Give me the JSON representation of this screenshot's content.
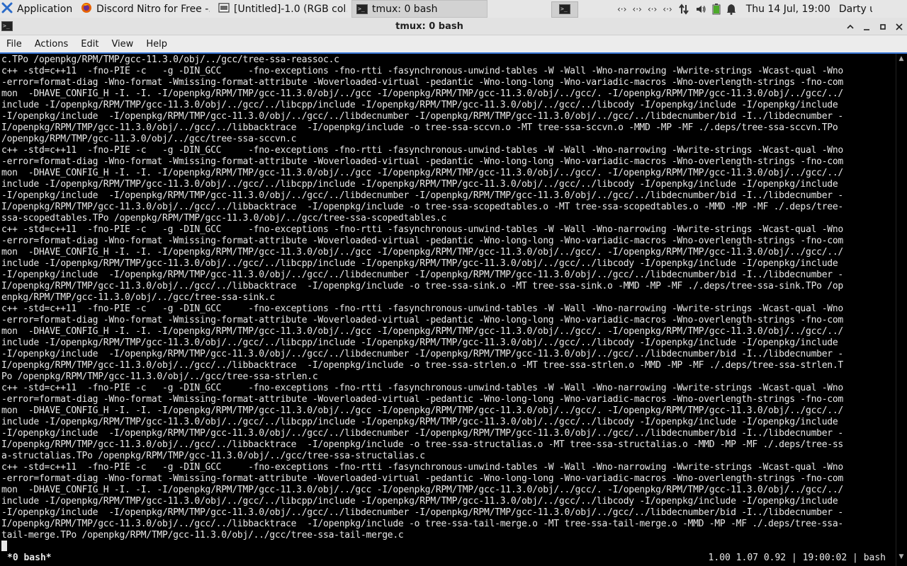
{
  "panel": {
    "apps_label": "Applications",
    "tasks": [
      {
        "label": "Discord Nitro for Free -...",
        "icon": "firefox-icon"
      },
      {
        "label": "[Untitled]-1.0 (RGB col...",
        "icon": "gimp-icon"
      },
      {
        "label": "tmux: 0 bash",
        "icon": "terminal-icon"
      }
    ],
    "tray": {
      "network_icons": [
        "network-icon",
        "network-icon",
        "network-icon",
        "network-icon"
      ],
      "other_icons": [
        "transfer-icon",
        "volume-icon",
        "battery-icon",
        "notification-bell-icon"
      ]
    },
    "clock": "Thu 14 Jul, 19:00",
    "user": "Darty uwu"
  },
  "window": {
    "title": "tmux: 0 bash"
  },
  "menubar": {
    "items": [
      "File",
      "Actions",
      "Edit",
      "View",
      "Help"
    ]
  },
  "terminal": {
    "lines": [
      "c.TPo /openpkg/RPM/TMP/gcc-11.3.0/obj/../gcc/tree-ssa-reassoc.c",
      "c++ -std=c++11  -fno-PIE -c   -g -DIN_GCC     -fno-exceptions -fno-rtti -fasynchronous-unwind-tables -W -Wall -Wno-narrowing -Wwrite-strings -Wcast-qual -Wno",
      "-error=format-diag -Wno-format -Wmissing-format-attribute -Woverloaded-virtual -pedantic -Wno-long-long -Wno-variadic-macros -Wno-overlength-strings -fno-com",
      "mon  -DHAVE_CONFIG_H -I. -I. -I/openpkg/RPM/TMP/gcc-11.3.0/obj/../gcc -I/openpkg/RPM/TMP/gcc-11.3.0/obj/../gcc/. -I/openpkg/RPM/TMP/gcc-11.3.0/obj/../gcc/../",
      "include -I/openpkg/RPM/TMP/gcc-11.3.0/obj/../gcc/../libcpp/include -I/openpkg/RPM/TMP/gcc-11.3.0/obj/../gcc/../libcody -I/openpkg/include -I/openpkg/include",
      "-I/openpkg/include  -I/openpkg/RPM/TMP/gcc-11.3.0/obj/../gcc/../libdecnumber -I/openpkg/RPM/TMP/gcc-11.3.0/obj/../gcc/../libdecnumber/bid -I../libdecnumber -",
      "I/openpkg/RPM/TMP/gcc-11.3.0/obj/../gcc/../libbacktrace  -I/openpkg/include -o tree-ssa-sccvn.o -MT tree-ssa-sccvn.o -MMD -MP -MF ./.deps/tree-ssa-sccvn.TPo",
      "/openpkg/RPM/TMP/gcc-11.3.0/obj/../gcc/tree-ssa-sccvn.c",
      "c++ -std=c++11  -fno-PIE -c   -g -DIN_GCC     -fno-exceptions -fno-rtti -fasynchronous-unwind-tables -W -Wall -Wno-narrowing -Wwrite-strings -Wcast-qual -Wno",
      "-error=format-diag -Wno-format -Wmissing-format-attribute -Woverloaded-virtual -pedantic -Wno-long-long -Wno-variadic-macros -Wno-overlength-strings -fno-com",
      "mon  -DHAVE_CONFIG_H -I. -I. -I/openpkg/RPM/TMP/gcc-11.3.0/obj/../gcc -I/openpkg/RPM/TMP/gcc-11.3.0/obj/../gcc/. -I/openpkg/RPM/TMP/gcc-11.3.0/obj/../gcc/../",
      "include -I/openpkg/RPM/TMP/gcc-11.3.0/obj/../gcc/../libcpp/include -I/openpkg/RPM/TMP/gcc-11.3.0/obj/../gcc/../libcody -I/openpkg/include -I/openpkg/include",
      "-I/openpkg/include  -I/openpkg/RPM/TMP/gcc-11.3.0/obj/../gcc/../libdecnumber -I/openpkg/RPM/TMP/gcc-11.3.0/obj/../gcc/../libdecnumber/bid -I../libdecnumber -",
      "I/openpkg/RPM/TMP/gcc-11.3.0/obj/../gcc/../libbacktrace  -I/openpkg/include -o tree-ssa-scopedtables.o -MT tree-ssa-scopedtables.o -MMD -MP -MF ./.deps/tree-",
      "ssa-scopedtables.TPo /openpkg/RPM/TMP/gcc-11.3.0/obj/../gcc/tree-ssa-scopedtables.c",
      "c++ -std=c++11  -fno-PIE -c   -g -DIN_GCC     -fno-exceptions -fno-rtti -fasynchronous-unwind-tables -W -Wall -Wno-narrowing -Wwrite-strings -Wcast-qual -Wno",
      "-error=format-diag -Wno-format -Wmissing-format-attribute -Woverloaded-virtual -pedantic -Wno-long-long -Wno-variadic-macros -Wno-overlength-strings -fno-com",
      "mon  -DHAVE_CONFIG_H -I. -I. -I/openpkg/RPM/TMP/gcc-11.3.0/obj/../gcc -I/openpkg/RPM/TMP/gcc-11.3.0/obj/../gcc/. -I/openpkg/RPM/TMP/gcc-11.3.0/obj/../gcc/../",
      "include -I/openpkg/RPM/TMP/gcc-11.3.0/obj/../gcc/../libcpp/include -I/openpkg/RPM/TMP/gcc-11.3.0/obj/../gcc/../libcody -I/openpkg/include -I/openpkg/include",
      "-I/openpkg/include  -I/openpkg/RPM/TMP/gcc-11.3.0/obj/../gcc/../libdecnumber -I/openpkg/RPM/TMP/gcc-11.3.0/obj/../gcc/../libdecnumber/bid -I../libdecnumber -",
      "I/openpkg/RPM/TMP/gcc-11.3.0/obj/../gcc/../libbacktrace  -I/openpkg/include -o tree-ssa-sink.o -MT tree-ssa-sink.o -MMD -MP -MF ./.deps/tree-ssa-sink.TPo /op",
      "enpkg/RPM/TMP/gcc-11.3.0/obj/../gcc/tree-ssa-sink.c",
      "c++ -std=c++11  -fno-PIE -c   -g -DIN_GCC     -fno-exceptions -fno-rtti -fasynchronous-unwind-tables -W -Wall -Wno-narrowing -Wwrite-strings -Wcast-qual -Wno",
      "-error=format-diag -Wno-format -Wmissing-format-attribute -Woverloaded-virtual -pedantic -Wno-long-long -Wno-variadic-macros -Wno-overlength-strings -fno-com",
      "mon  -DHAVE_CONFIG_H -I. -I. -I/openpkg/RPM/TMP/gcc-11.3.0/obj/../gcc -I/openpkg/RPM/TMP/gcc-11.3.0/obj/../gcc/. -I/openpkg/RPM/TMP/gcc-11.3.0/obj/../gcc/../",
      "include -I/openpkg/RPM/TMP/gcc-11.3.0/obj/../gcc/../libcpp/include -I/openpkg/RPM/TMP/gcc-11.3.0/obj/../gcc/../libcody -I/openpkg/include -I/openpkg/include",
      "-I/openpkg/include  -I/openpkg/RPM/TMP/gcc-11.3.0/obj/../gcc/../libdecnumber -I/openpkg/RPM/TMP/gcc-11.3.0/obj/../gcc/../libdecnumber/bid -I../libdecnumber -",
      "I/openpkg/RPM/TMP/gcc-11.3.0/obj/../gcc/../libbacktrace  -I/openpkg/include -o tree-ssa-strlen.o -MT tree-ssa-strlen.o -MMD -MP -MF ./.deps/tree-ssa-strlen.T",
      "Po /openpkg/RPM/TMP/gcc-11.3.0/obj/../gcc/tree-ssa-strlen.c",
      "c++ -std=c++11  -fno-PIE -c   -g -DIN_GCC     -fno-exceptions -fno-rtti -fasynchronous-unwind-tables -W -Wall -Wno-narrowing -Wwrite-strings -Wcast-qual -Wno",
      "-error=format-diag -Wno-format -Wmissing-format-attribute -Woverloaded-virtual -pedantic -Wno-long-long -Wno-variadic-macros -Wno-overlength-strings -fno-com",
      "mon  -DHAVE_CONFIG_H -I. -I. -I/openpkg/RPM/TMP/gcc-11.3.0/obj/../gcc -I/openpkg/RPM/TMP/gcc-11.3.0/obj/../gcc/. -I/openpkg/RPM/TMP/gcc-11.3.0/obj/../gcc/../",
      "include -I/openpkg/RPM/TMP/gcc-11.3.0/obj/../gcc/../libcpp/include -I/openpkg/RPM/TMP/gcc-11.3.0/obj/../gcc/../libcody -I/openpkg/include -I/openpkg/include",
      "-I/openpkg/include  -I/openpkg/RPM/TMP/gcc-11.3.0/obj/../gcc/../libdecnumber -I/openpkg/RPM/TMP/gcc-11.3.0/obj/../gcc/../libdecnumber/bid -I../libdecnumber -",
      "I/openpkg/RPM/TMP/gcc-11.3.0/obj/../gcc/../libbacktrace  -I/openpkg/include -o tree-ssa-structalias.o -MT tree-ssa-structalias.o -MMD -MP -MF ./.deps/tree-ss",
      "a-structalias.TPo /openpkg/RPM/TMP/gcc-11.3.0/obj/../gcc/tree-ssa-structalias.c",
      "c++ -std=c++11  -fno-PIE -c   -g -DIN_GCC     -fno-exceptions -fno-rtti -fasynchronous-unwind-tables -W -Wall -Wno-narrowing -Wwrite-strings -Wcast-qual -Wno",
      "-error=format-diag -Wno-format -Wmissing-format-attribute -Woverloaded-virtual -pedantic -Wno-long-long -Wno-variadic-macros -Wno-overlength-strings -fno-com",
      "mon  -DHAVE_CONFIG_H -I. -I. -I/openpkg/RPM/TMP/gcc-11.3.0/obj/../gcc -I/openpkg/RPM/TMP/gcc-11.3.0/obj/../gcc/. -I/openpkg/RPM/TMP/gcc-11.3.0/obj/../gcc/../",
      "include -I/openpkg/RPM/TMP/gcc-11.3.0/obj/../gcc/../libcpp/include -I/openpkg/RPM/TMP/gcc-11.3.0/obj/../gcc/../libcody -I/openpkg/include -I/openpkg/include",
      "-I/openpkg/include  -I/openpkg/RPM/TMP/gcc-11.3.0/obj/../gcc/../libdecnumber -I/openpkg/RPM/TMP/gcc-11.3.0/obj/../gcc/../libdecnumber/bid -I../libdecnumber -",
      "I/openpkg/RPM/TMP/gcc-11.3.0/obj/../gcc/../libbacktrace  -I/openpkg/include -o tree-ssa-tail-merge.o -MT tree-ssa-tail-merge.o -MMD -MP -MF ./.deps/tree-ssa-",
      "tail-merge.TPo /openpkg/RPM/TMP/gcc-11.3.0/obj/../gcc/tree-ssa-tail-merge.c"
    ]
  },
  "tmux": {
    "window_label": "*0 bash*",
    "status_right": "1.00 1.07 0.92 | 19:00:02 | bash"
  },
  "colors": {
    "panel_bg": "#e6e6e6",
    "terminal_bg": "#000000",
    "terminal_fg": "#e8e8e8",
    "focus_accent": "#3b78d8"
  }
}
